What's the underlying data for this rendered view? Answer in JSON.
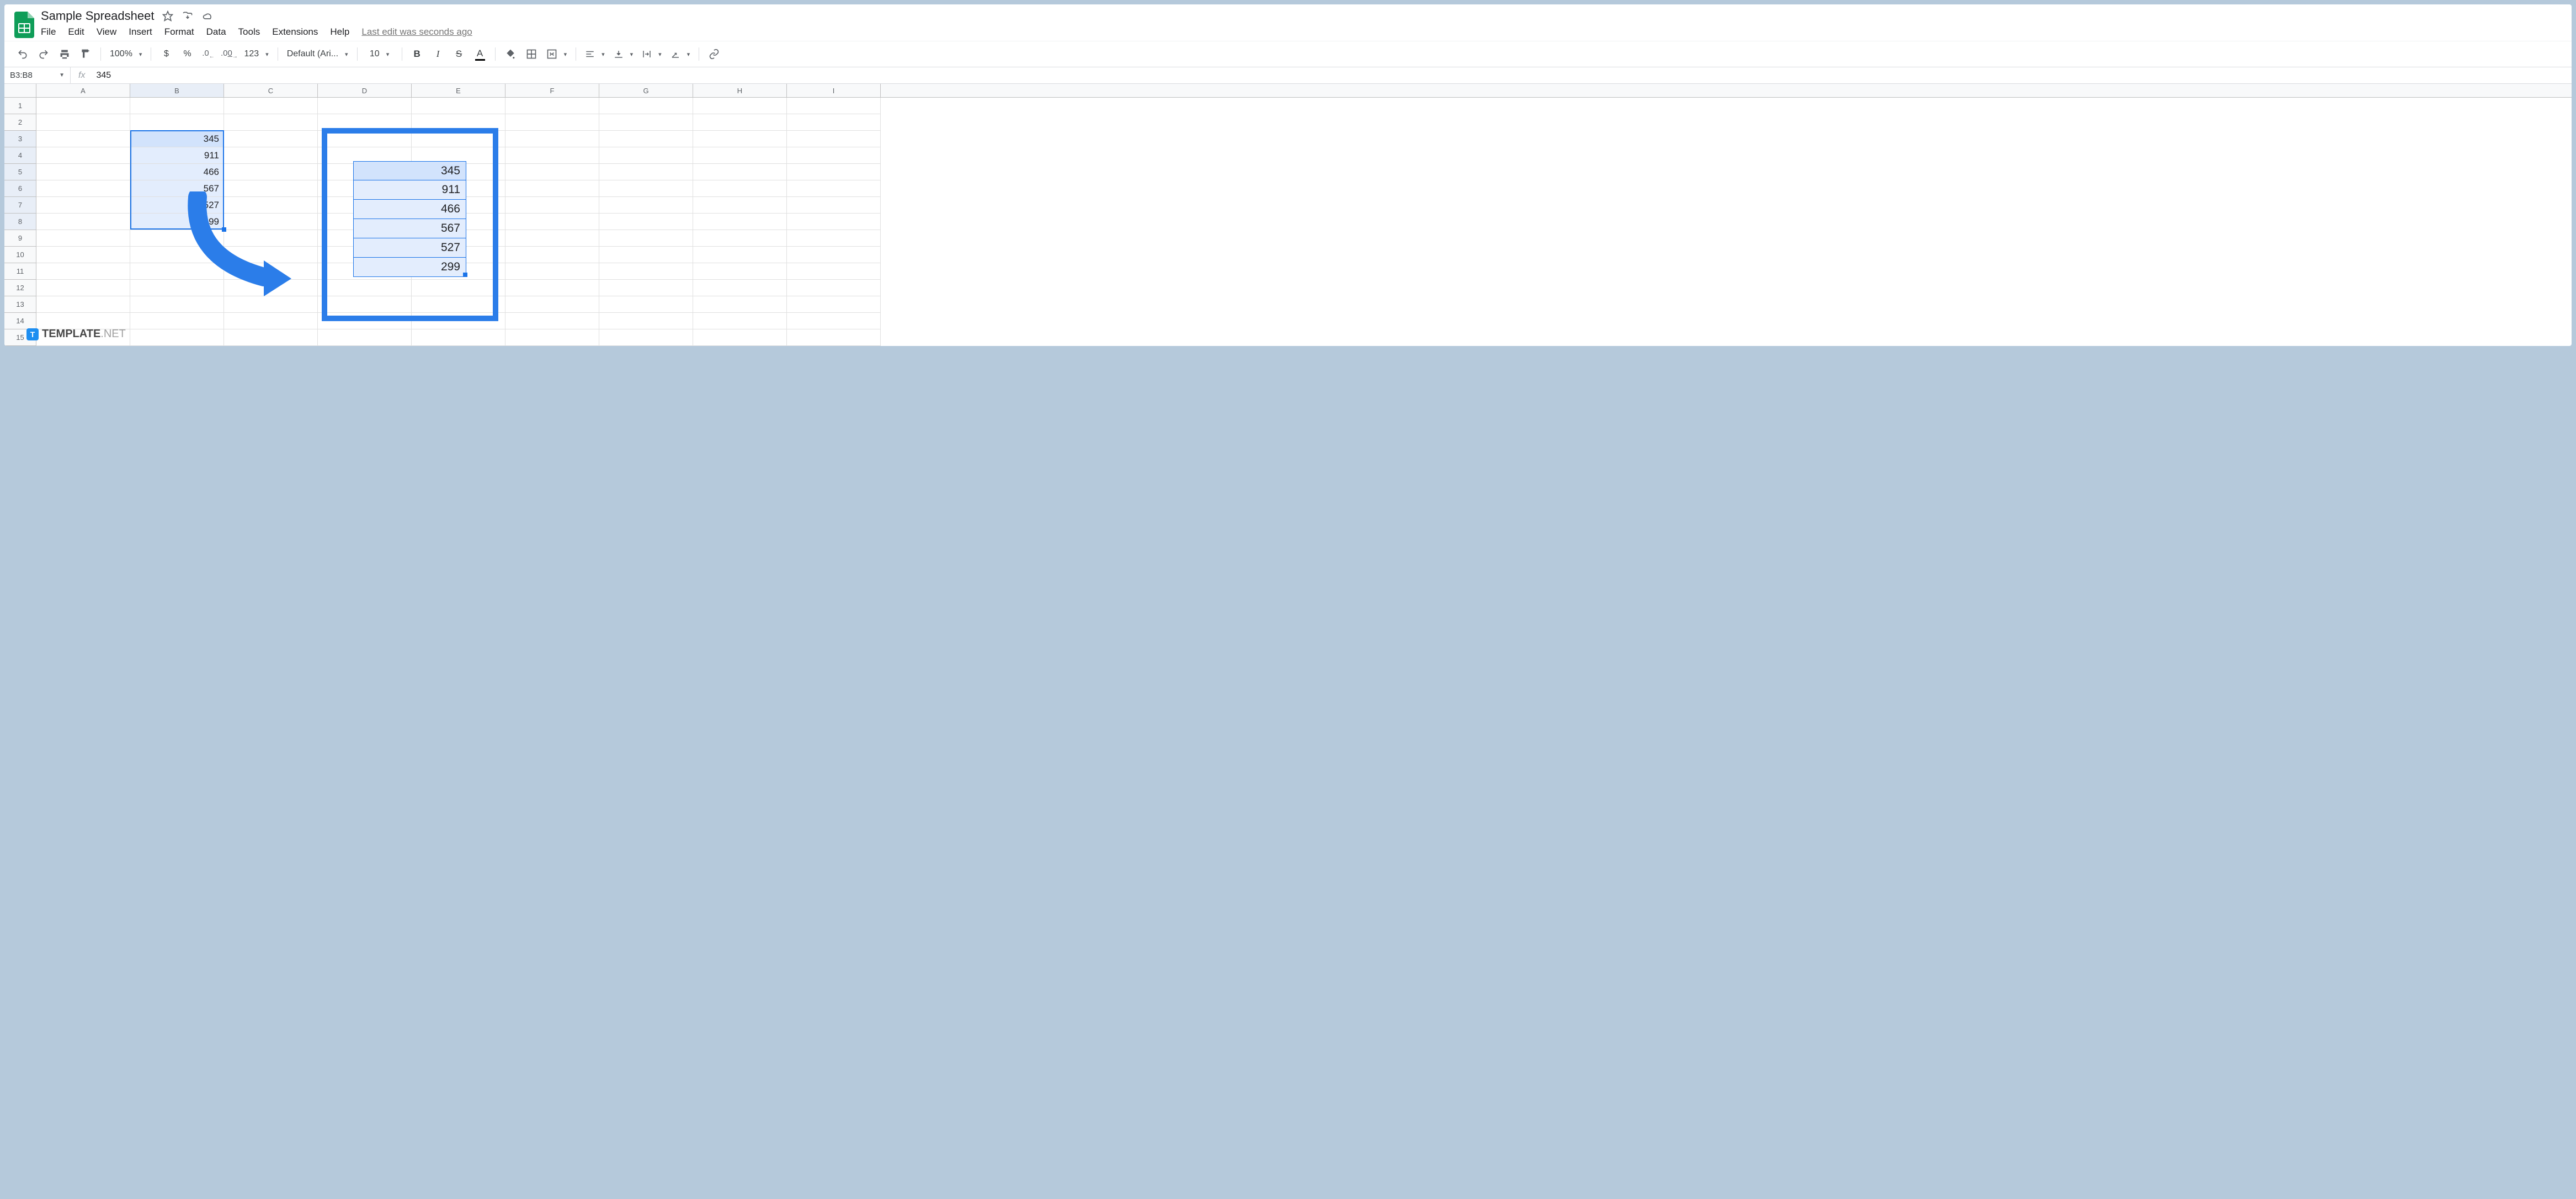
{
  "doc": {
    "title": "Sample Spreadsheet"
  },
  "menubar": {
    "file": "File",
    "edit": "Edit",
    "view": "View",
    "insert": "Insert",
    "format": "Format",
    "data": "Data",
    "tools": "Tools",
    "extensions": "Extensions",
    "help": "Help",
    "last_edit": "Last edit was seconds ago"
  },
  "toolbar": {
    "zoom": "100%",
    "currency": "$",
    "percent": "%",
    "dec_less": ".0",
    "dec_more": ".00",
    "numfmt": "123",
    "font": "Default (Ari...",
    "fontsize": "10",
    "bold": "B",
    "italic": "I",
    "strike": "S",
    "textcolor": "A"
  },
  "formula": {
    "namebox": "B3:B8",
    "value": "345"
  },
  "columns": [
    "A",
    "B",
    "C",
    "D",
    "E",
    "F",
    "G",
    "H",
    "I"
  ],
  "row_count": 15,
  "selected_column_index": 1,
  "selected_rows": [
    3,
    4,
    5,
    6,
    7,
    8
  ],
  "cells": {
    "B3": "345",
    "B4": "911",
    "B5": "466",
    "B6": "567",
    "B7": "527",
    "B8": "299"
  },
  "zoom_values": [
    "345",
    "911",
    "466",
    "567",
    "527",
    "299"
  ],
  "watermark": {
    "brand": "TEMPLATE",
    "suffix": ".NET",
    "badge": "T"
  }
}
